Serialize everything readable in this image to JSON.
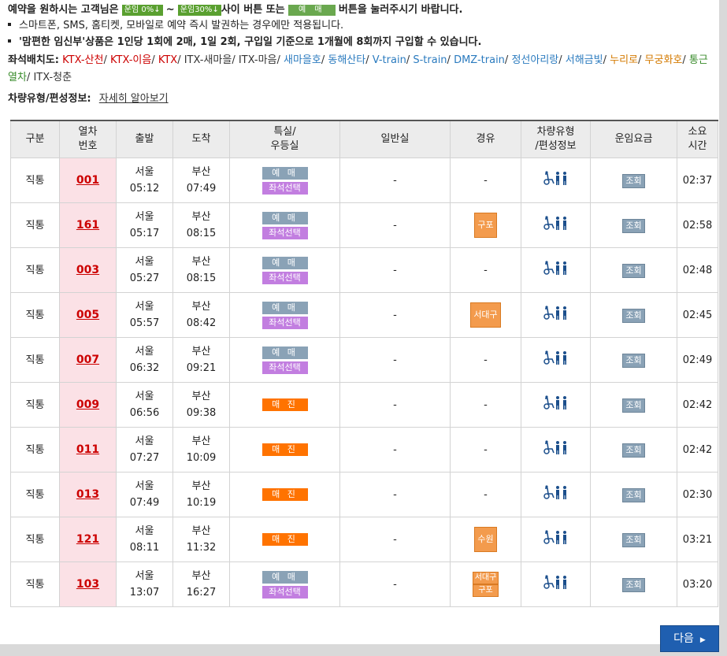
{
  "notice": {
    "before": "예약을 원하시는 고객님은",
    "badge1": "운임 0%",
    "tilde": "~",
    "badge2": "운임30%",
    "middle": "사이 버튼 또는",
    "badge3": "예 매",
    "after": "버튼을 눌러주시기 바랍니다."
  },
  "bullets": [
    "스마트폰, SMS, 홈티켓, 모바일로 예약 즉시 발권하는 경우에만 적용됩니다.",
    "'맘편한 임신부'상품은 1인당 1회에 2매, 1일 2회, 구입일 기준으로 1개월에 8회까지 구입할 수 있습니다."
  ],
  "seat_map": {
    "label": "좌석배치도:",
    "links": [
      {
        "text": "KTX-산천",
        "color": "#cc0000"
      },
      {
        "text": "KTX-이음",
        "color": "#cc0000"
      },
      {
        "text": "KTX",
        "color": "#cc0000"
      },
      {
        "text": "ITX-새마을",
        "color": "#333333"
      },
      {
        "text": "ITX-마음",
        "color": "#333333"
      },
      {
        "text": "새마을호",
        "color": "#2b7bbf"
      },
      {
        "text": "동해산타",
        "color": "#2b7bbf"
      },
      {
        "text": "V-train",
        "color": "#2b7bbf"
      },
      {
        "text": "S-train",
        "color": "#2b7bbf"
      },
      {
        "text": "DMZ-train",
        "color": "#2b7bbf"
      },
      {
        "text": "정선아리랑",
        "color": "#2b7bbf"
      },
      {
        "text": "서해금빛",
        "color": "#2b7bbf"
      },
      {
        "text": "누리로",
        "color": "#d47a00"
      },
      {
        "text": "무궁화호",
        "color": "#d47a00"
      },
      {
        "text": "통근열차",
        "color": "#3a8c2c"
      },
      {
        "text": "ITX-청춘",
        "color": "#333333"
      }
    ]
  },
  "vehicle_info": {
    "label": "차량유형/편성정보:",
    "link": "자세히 알아보기"
  },
  "headers": [
    "구분",
    "열차\n번호",
    "출발",
    "도착",
    "특실/\n우등실",
    "일반실",
    "경유",
    "차량유형\n/편성정보",
    "운임요금",
    "소요\n시간"
  ],
  "labels": {
    "reserve": "예 매",
    "seat_select": "좌석선택",
    "sold_out": "매 진",
    "dash": "-",
    "inquiry": "조회",
    "vehicle_icon": "wheelchair-family-icon"
  },
  "trains": [
    {
      "type": "직통",
      "no": "001",
      "dep_st": "서울",
      "dep_t": "05:12",
      "arr_st": "부산",
      "arr_t": "07:49",
      "special": "reserve_seat",
      "general": "-",
      "via": [],
      "duration": "02:37"
    },
    {
      "type": "직통",
      "no": "161",
      "dep_st": "서울",
      "dep_t": "05:17",
      "arr_st": "부산",
      "arr_t": "08:15",
      "special": "reserve_seat",
      "general": "-",
      "via": [
        "구포"
      ],
      "duration": "02:58"
    },
    {
      "type": "직통",
      "no": "003",
      "dep_st": "서울",
      "dep_t": "05:27",
      "arr_st": "부산",
      "arr_t": "08:15",
      "special": "reserve_seat",
      "general": "-",
      "via": [],
      "duration": "02:48"
    },
    {
      "type": "직통",
      "no": "005",
      "dep_st": "서울",
      "dep_t": "05:57",
      "arr_st": "부산",
      "arr_t": "08:42",
      "special": "reserve_seat",
      "general": "-",
      "via": [
        "서대구"
      ],
      "duration": "02:45"
    },
    {
      "type": "직통",
      "no": "007",
      "dep_st": "서울",
      "dep_t": "06:32",
      "arr_st": "부산",
      "arr_t": "09:21",
      "special": "reserve_seat",
      "general": "-",
      "via": [],
      "duration": "02:49"
    },
    {
      "type": "직통",
      "no": "009",
      "dep_st": "서울",
      "dep_t": "06:56",
      "arr_st": "부산",
      "arr_t": "09:38",
      "special": "sold",
      "general": "-",
      "via": [],
      "duration": "02:42"
    },
    {
      "type": "직통",
      "no": "011",
      "dep_st": "서울",
      "dep_t": "07:27",
      "arr_st": "부산",
      "arr_t": "10:09",
      "special": "sold",
      "general": "-",
      "via": [],
      "duration": "02:42"
    },
    {
      "type": "직통",
      "no": "013",
      "dep_st": "서울",
      "dep_t": "07:49",
      "arr_st": "부산",
      "arr_t": "10:19",
      "special": "sold",
      "general": "-",
      "via": [],
      "duration": "02:30"
    },
    {
      "type": "직통",
      "no": "121",
      "dep_st": "서울",
      "dep_t": "08:11",
      "arr_st": "부산",
      "arr_t": "11:32",
      "special": "sold",
      "general": "-",
      "via": [
        "수원"
      ],
      "duration": "03:21"
    },
    {
      "type": "직통",
      "no": "103",
      "dep_st": "서울",
      "dep_t": "13:07",
      "arr_st": "부산",
      "arr_t": "16:27",
      "special": "reserve_seat",
      "general": "-",
      "via": [
        "서대구",
        "구포"
      ],
      "duration": "03:20"
    }
  ],
  "next_button": "다음"
}
